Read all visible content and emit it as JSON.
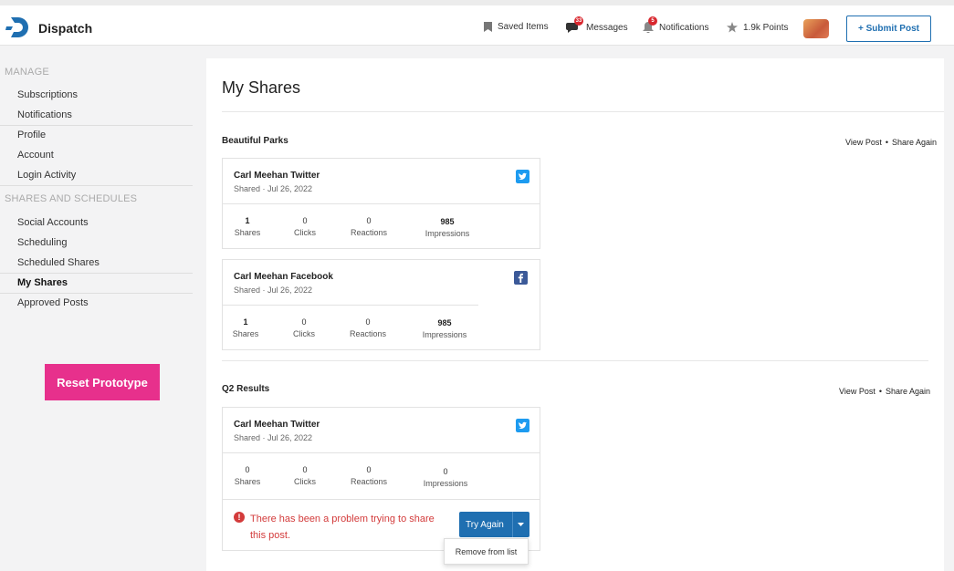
{
  "app": {
    "name": "Dispatch"
  },
  "header": {
    "saved_items": "Saved Items",
    "messages": "Messages",
    "messages_count": "33",
    "notifications": "Notifications",
    "notifications_count": "5",
    "points": "1.9k Points",
    "submit_post": "+ Submit Post"
  },
  "sidebar": {
    "manage_title": "MANAGE",
    "manage_items": [
      "Subscriptions",
      "Notifications",
      "Profile",
      "Account",
      "Login Activity"
    ],
    "shares_title": "SHARES AND SCHEDULES",
    "shares_items": [
      "Social Accounts",
      "Scheduling",
      "Scheduled Shares",
      "My Shares",
      "Approved Posts"
    ],
    "active_item": "My Shares",
    "reset_button": "Reset Prototype"
  },
  "main": {
    "title": "My Shares",
    "groups": [
      {
        "title": "Beautiful Parks",
        "view_post": "View Post",
        "share_again": "Share Again",
        "cards": [
          {
            "name": "Carl Meehan Twitter",
            "sub": "Shared · Jul 26, 2022",
            "network": "twitter",
            "stats": [
              {
                "value": "1",
                "label": "Shares"
              },
              {
                "value": "0",
                "label": "Clicks"
              },
              {
                "value": "0",
                "label": "Reactions"
              },
              {
                "value": "985",
                "label": "Impressions"
              }
            ]
          },
          {
            "name": "Carl Meehan Facebook",
            "sub": "Shared · Jul 26, 2022",
            "network": "facebook",
            "stats": [
              {
                "value": "1",
                "label": "Shares"
              },
              {
                "value": "0",
                "label": "Clicks"
              },
              {
                "value": "0",
                "label": "Reactions"
              },
              {
                "value": "985",
                "label": "Impressions"
              }
            ]
          }
        ]
      },
      {
        "title": "Q2 Results",
        "view_post": "View Post",
        "share_again": "Share Again",
        "cards": [
          {
            "name": "Carl Meehan Twitter",
            "sub": "Shared · Jul 26, 2022",
            "network": "twitter",
            "stats": [
              {
                "value": "0",
                "label": "Shares"
              },
              {
                "value": "0",
                "label": "Clicks"
              },
              {
                "value": "0",
                "label": "Reactions"
              },
              {
                "value": "0",
                "label": "Impressions"
              }
            ],
            "error": "There has been a problem trying to share this post.",
            "try_again": "Try Again",
            "dropdown_option": "Remove from list"
          }
        ]
      }
    ]
  },
  "colors": {
    "brand_blue": "#1f6fb1",
    "twitter": "#1d9bf0",
    "facebook": "#3b5998",
    "error": "#d33b3b",
    "reset": "#e7308c"
  }
}
